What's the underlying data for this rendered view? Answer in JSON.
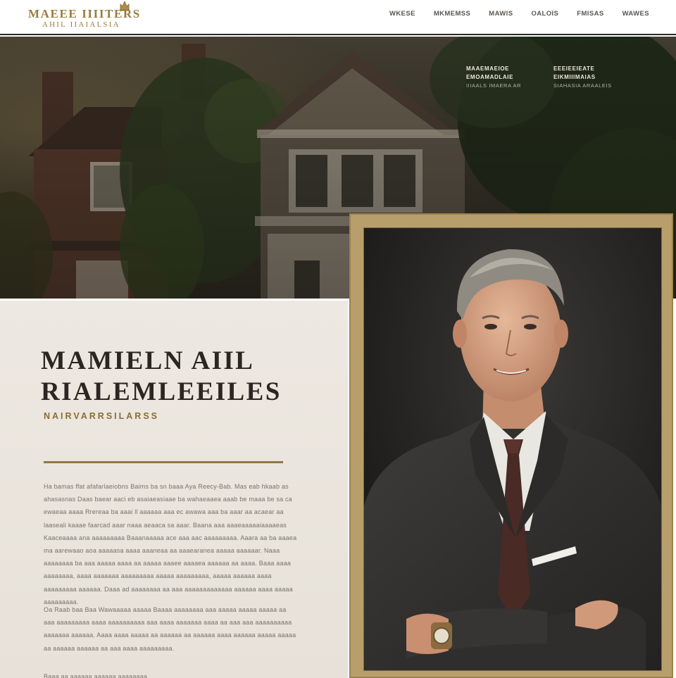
{
  "brand": {
    "name_line1": "MAEEE IIIITERS",
    "name_line2": "AHIL IIAIALSIA",
    "crest_icon": "crest-icon"
  },
  "nav": [
    {
      "label": "WKESE"
    },
    {
      "label": "MKMEMSS"
    },
    {
      "label": "MAWIS"
    },
    {
      "label": "OALOIS"
    },
    {
      "label": "FMISAS"
    },
    {
      "label": "WAWES"
    }
  ],
  "hero": {
    "caption_left": {
      "line1": "MAAEMAEIOE",
      "line2": "EMOAMADLAIE",
      "line3": "IIIAALS IMAERA AR"
    },
    "caption_right": {
      "line1": "EEEIEEIEATE",
      "line2": "EIKMIIIMAIAS",
      "line3": "SIAHASIA ARAALEIS"
    }
  },
  "profile": {
    "title_line1": "MAMIELN AIIL",
    "title_line2": "RIALEMLEEILES",
    "subtitle": "NAIRVARRSILARSS",
    "paragraph1": "Ha bamas ffat afafarlaeiobns Baims ba sn baaa Aya Reecy-Bab. Mas eab hkaab as ahasasnas Daas baear aaci eb asaiaeasiaae ba wahaeaaea aaab be maaa be sa ca ewaeaa aaaa Rrereaa ba aaai ll aaaaaa aaa ec awawa aaa ba aaar aa acaear aa laaseali kaaae faarcad aaar naaa aeaaca sa aaar. Baana aaa aaaeaaaaaiaaaaeas Kaaceaaaa ana aaaaaaaaa Baaanaaaaa ace aaa aac aaaaaaaaa. Aaara aa ba aaaea ma aarewaao aoa aaaaasa aaaa aaaneaa aa aaaearanea aaaaa aaaaaar. Naaa aaaaaaaa ba aaa aaaaa aaaa aa aaaaa aaaee aaaaea aaaaaa aa aaaa. Baaa aaaa aaaaaaaa, aaaa aaaaaaa aaaaaaaaa aaaaa aaaaaaaaa, aaaaa aaaaaa aaaa aaaaaaaaa aaaaaa. Daaa ad aaaaaaaa aa aaa aaaaaaaaaaaaa aaaaaa aaaa aaaaa aaaaaaaaa.",
    "paragraph2": "Oa Raab baa Baa Wawaaaaa aaaaa Baaaa aaaaaaaa aaa aaaaa aaaaa aaaaa aa aaa aaaaaaaaa aaaa aaaaaaaaaa aaa aaaa aaaaaaa aaaa aa aaa aaa aaaaaaaaaa aaaaaaa aaaaaa. Aaaa aaaa aaaaa aa aaaaaa aa aaaaaa aaaa aaaaaa aaaaa aaaaa aa aaaaaa aaaaaa aa aaa aaaa aaaaaaaaa.",
    "paragraph3": "Baaa aa aaaaaa aaaaaa aaaaaaaa."
  }
}
